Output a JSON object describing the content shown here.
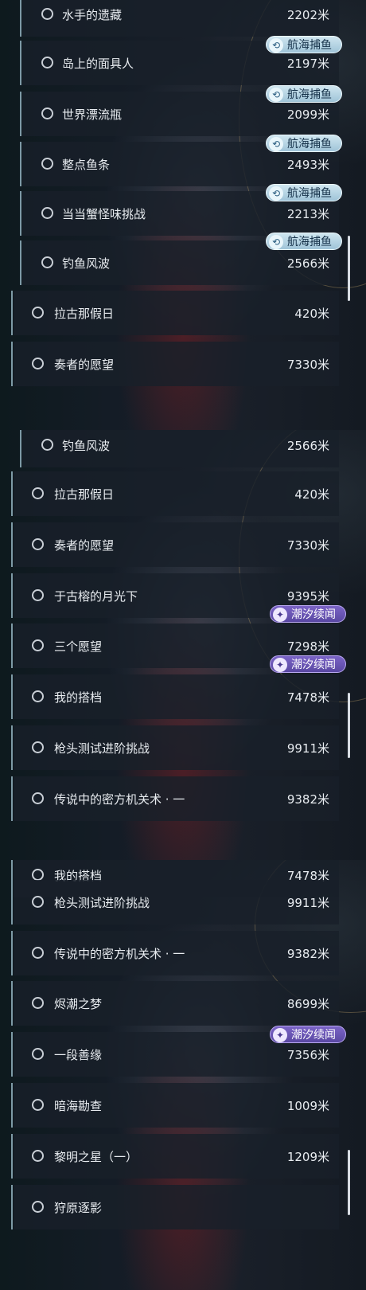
{
  "panels": [
    {
      "name": "panel-1",
      "rows": [
        {
          "name": "水手的遗藏",
          "distance": "2202米",
          "variant": "sub"
        },
        {
          "name": "岛上的面具人",
          "distance": "2197米",
          "variant": "sub",
          "tag": "fish"
        },
        {
          "name": "世界漂流瓶",
          "distance": "2099米",
          "variant": "sub",
          "tag": "fish"
        },
        {
          "name": "整点鱼条",
          "distance": "2493米",
          "variant": "sub",
          "tag": "fish"
        },
        {
          "name": "当当蟹怪味挑战",
          "distance": "2213米",
          "variant": "sub",
          "tag": "fish"
        },
        {
          "name": "钓鱼风波",
          "distance": "2566米",
          "variant": "sub",
          "tag": "fish"
        },
        {
          "name": "拉古那假日",
          "distance": "420米",
          "variant": "main"
        },
        {
          "name": "奏者的愿望",
          "distance": "7330米",
          "variant": "main"
        }
      ]
    },
    {
      "name": "panel-2",
      "rows": [
        {
          "name": "钓鱼风波",
          "distance": "2566米",
          "variant": "sub"
        },
        {
          "name": "拉古那假日",
          "distance": "420米",
          "variant": "main"
        },
        {
          "name": "奏者的愿望",
          "distance": "7330米",
          "variant": "main"
        },
        {
          "name": "于古榕的月光下",
          "distance": "9395米",
          "variant": "main"
        },
        {
          "name": "三个愿望",
          "distance": "7298米",
          "variant": "main",
          "tag": "tide"
        },
        {
          "name": "我的搭档",
          "distance": "7478米",
          "variant": "main",
          "tag": "tide"
        },
        {
          "name": "枪头测试进阶挑战",
          "distance": "9911米",
          "variant": "main"
        },
        {
          "name": "传说中的密方机关术 · 一",
          "distance": "9382米",
          "variant": "main"
        }
      ]
    },
    {
      "name": "panel-3",
      "rows": [
        {
          "name": "我的搭档",
          "distance": "7478米",
          "variant": "main"
        },
        {
          "name": "枪头测试进阶挑战",
          "distance": "9911米",
          "variant": "main"
        },
        {
          "name": "传说中的密方机关术 · 一",
          "distance": "9382米",
          "variant": "main"
        },
        {
          "name": "烬潮之梦",
          "distance": "8699米",
          "variant": "main"
        },
        {
          "name": "一段善缘",
          "distance": "7356米",
          "variant": "main",
          "tag": "tide"
        },
        {
          "name": "暗海勘查",
          "distance": "1009米",
          "variant": "main"
        },
        {
          "name": "黎明之星（一）",
          "distance": "1209米",
          "variant": "main"
        },
        {
          "name": "狩原逐影",
          "distance": "",
          "variant": "main"
        }
      ]
    }
  ],
  "tags": {
    "fish": {
      "label": "航海捕鱼",
      "icon": "fishing-hook-icon",
      "color": "#a9cfe0"
    },
    "tide": {
      "label": "潮汐续闻",
      "icon": "tide-wave-icon",
      "color": "#6a55b5"
    }
  },
  "colors": {
    "text": "#e8ecf0",
    "row_bg": "#18202a",
    "accent": "#7e9aa6"
  }
}
